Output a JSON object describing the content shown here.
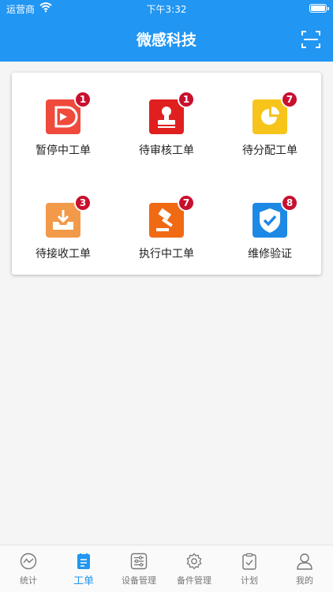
{
  "status_bar": {
    "carrier": "运营商",
    "time": "下午3:32"
  },
  "header": {
    "title": "微感科技"
  },
  "grid": [
    {
      "label": "暂停中工单",
      "badge": "1",
      "color": "#ef4a3c",
      "icon": "play-icon"
    },
    {
      "label": "待审核工单",
      "badge": "1",
      "color": "#e0201f",
      "icon": "stamp-icon"
    },
    {
      "label": "待分配工单",
      "badge": "7",
      "color": "#f6c41a",
      "icon": "pie-chart-icon"
    },
    {
      "label": "待接收工单",
      "badge": "3",
      "color": "#f39a4a",
      "icon": "inbox-download-icon"
    },
    {
      "label": "执行中工单",
      "badge": "7",
      "color": "#f06a14",
      "icon": "gavel-icon"
    },
    {
      "label": "维修验证",
      "badge": "8",
      "color": "#1e88e5",
      "icon": "shield-check-icon"
    }
  ],
  "tabs": [
    {
      "label": "统计",
      "icon": "chart-circle-icon",
      "active": false
    },
    {
      "label": "工单",
      "icon": "work-order-icon",
      "active": true
    },
    {
      "label": "设备管理",
      "icon": "sliders-icon",
      "active": false
    },
    {
      "label": "备件管理",
      "icon": "gear-icon",
      "active": false
    },
    {
      "label": "计划",
      "icon": "clipboard-check-icon",
      "active": false
    },
    {
      "label": "我的",
      "icon": "user-icon",
      "active": false
    }
  ],
  "colors": {
    "primary": "#2196f3",
    "badge": "#c8102e"
  }
}
